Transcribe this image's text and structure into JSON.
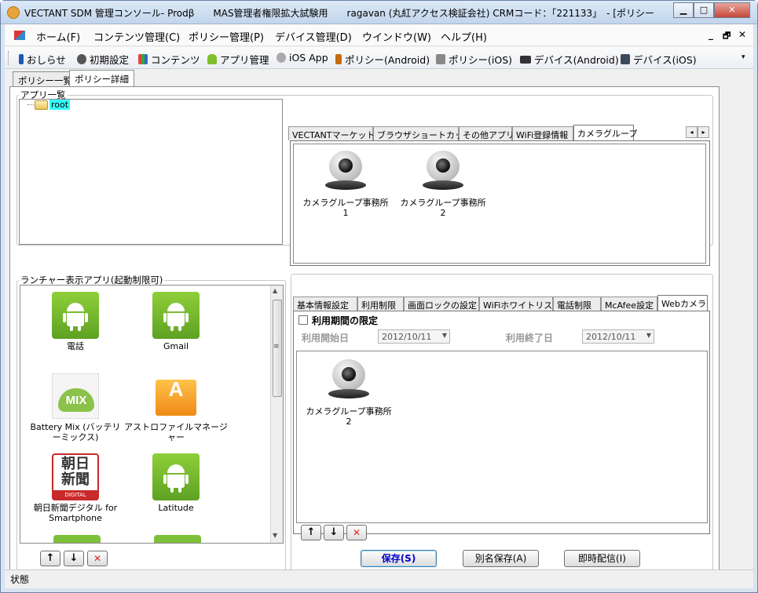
{
  "window": {
    "title": "VECTANT SDM 管理コンソール- Prodβ　　MAS管理者権限拡大試験用　　ragavan (丸紅アクセス検証会社)  CRMコード：「221133」　- [ポリシー",
    "min_glyph": "▁",
    "max_glyph": "□",
    "close_glyph": "✕"
  },
  "menubar": {
    "items": [
      "ホーム(F)",
      "コンテンツ管理(C)",
      "ポリシー管理(P)",
      "デバイス管理(D)",
      "ウインドウ(W)",
      "ヘルプ(H)"
    ],
    "mdi_min": "_",
    "mdi_restore": "🗗",
    "mdi_close": "✕"
  },
  "toolbar": {
    "items": [
      "おしらせ",
      "初期設定",
      "コンテンツ",
      "アプリ管理",
      "iOS App",
      "ポリシー(Android)",
      "ポリシー(iOS)",
      "デバイス(Android)",
      "デバイス(iOS)"
    ],
    "overflow_glyph": "▾"
  },
  "doc_tabs": [
    "ポリシー一覧",
    "ポリシー詳細"
  ],
  "app_list": {
    "legend": "アプリ一覧",
    "tree_root": "root",
    "tabs": [
      "VECTANTマーケット",
      "ブラウザショートカット",
      "その他アプリ",
      "WiFi登録情報",
      "カメラグループ"
    ],
    "scroll_left": "◂",
    "scroll_right": "▸",
    "items": [
      "カメラグループ事務所1",
      "カメラグループ事務所2"
    ]
  },
  "launcher": {
    "legend": "ランチャー表示アプリ(起動制限可)",
    "apps": [
      {
        "label": "電話",
        "icon": "android-icon"
      },
      {
        "label": "Gmail",
        "icon": "android-icon"
      },
      {
        "label": "Battery Mix (バッテリーミックス)",
        "icon": "battery-mix-icon",
        "icon_text": "MIX"
      },
      {
        "label": "アストロファイルマネージャー",
        "icon": "astro-file-manager-icon",
        "icon_text": "A"
      },
      {
        "label": "朝日新聞デジタル for Smartphone",
        "icon": "asahi-digital-icon",
        "icon_text": "朝日\n新聞",
        "icon_sub": "DIGITAL"
      },
      {
        "label": "Latitude",
        "icon": "android-icon"
      }
    ],
    "up": "↑",
    "down": "↓",
    "del": "✕",
    "scroll_up": "▲",
    "scroll_down": "▼",
    "scroll_grip": "≡"
  },
  "settings": {
    "tabs": [
      "基本情報設定",
      "利用制限",
      "画面ロックの設定",
      "WiFiホワイトリスト",
      "電話制限",
      "McAfee設定",
      "Webカメラ"
    ],
    "period_checkbox": "利用期間の限定",
    "start_label": "利用開始日",
    "start_value": "2012/10/11",
    "end_label": "利用終了日",
    "end_value": "2012/10/11",
    "dropdown_glyph": "▼",
    "camera_items": [
      "カメラグループ事務所2"
    ],
    "up": "↑",
    "down": "↓",
    "del": "✕"
  },
  "buttons": {
    "save": "保存(S)",
    "save_as": "別名保存(A)",
    "deliver": "即時配信(I)"
  },
  "status": "状態"
}
